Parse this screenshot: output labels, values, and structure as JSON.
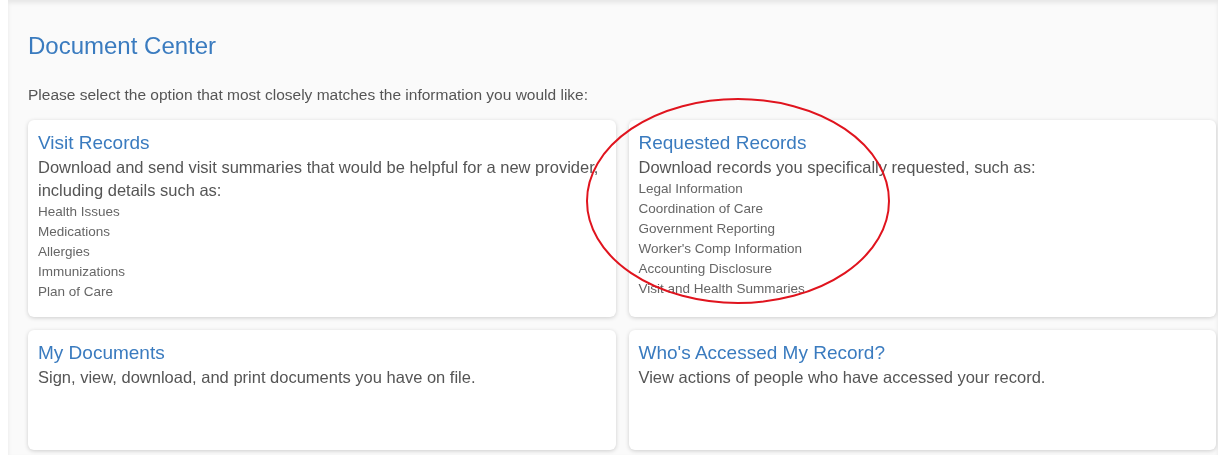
{
  "title": "Document Center",
  "intro": "Please select the option that most closely matches the information you would like:",
  "cards": [
    {
      "title": "Visit Records",
      "description": "Download and send visit summaries that would be helpful for a new provider, including details such as:",
      "items": [
        "Health Issues",
        "Medications",
        "Allergies",
        "Immunizations",
        "Plan of Care"
      ]
    },
    {
      "title": "Requested Records",
      "description": "Download records you specifically requested, such as:",
      "items": [
        "Legal Information",
        "Coordination of Care",
        "Government Reporting",
        "Worker's Comp Information",
        "Accounting Disclosure",
        "Visit and Health Summaries"
      ]
    },
    {
      "title": "My Documents",
      "description": "Sign, view, download, and print documents you have on file."
    },
    {
      "title": "Who's Accessed My Record?",
      "description": "View actions of people who have accessed your record."
    }
  ]
}
